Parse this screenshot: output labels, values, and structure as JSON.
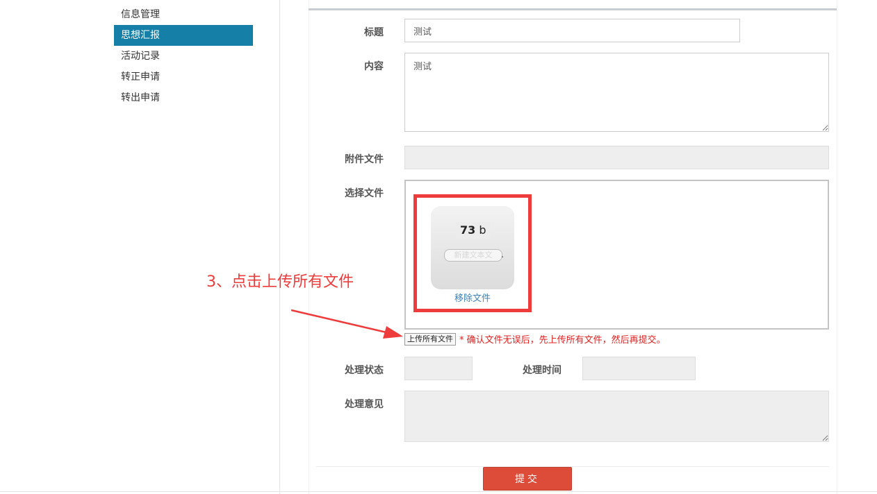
{
  "sidebar": {
    "items": [
      {
        "label": "信息管理",
        "active": false
      },
      {
        "label": "思想汇报",
        "active": true
      },
      {
        "label": "活动记录",
        "active": false
      },
      {
        "label": "转正申请",
        "active": false
      },
      {
        "label": "转出申请",
        "active": false
      }
    ]
  },
  "form": {
    "title_label": "标题",
    "title_value": "测试",
    "content_label": "内容",
    "content_value": "测试",
    "attachment_label": "附件文件",
    "attachment_value": "",
    "choose_file_label": "选择文件",
    "file": {
      "size_number": "73",
      "size_unit": "b",
      "name": "新建文本文",
      "name_suffix": ".",
      "remove_label": "移除文件"
    },
    "upload_all_label": "上传所有文件",
    "upload_hint": "* 确认文件无误后，先上传所有文件，然后再提交。",
    "status_label": "处理状态",
    "status_value": "",
    "time_label": "处理时间",
    "time_value": "",
    "opinion_label": "处理意见",
    "opinion_value": "",
    "submit_label": "提交"
  },
  "annotation": {
    "text": "3、点击上传所有文件",
    "color": "#ee3b3b"
  },
  "colors": {
    "sidebar_active": "#157fa8",
    "submit": "#dd4b39",
    "hint": "#e02020"
  }
}
